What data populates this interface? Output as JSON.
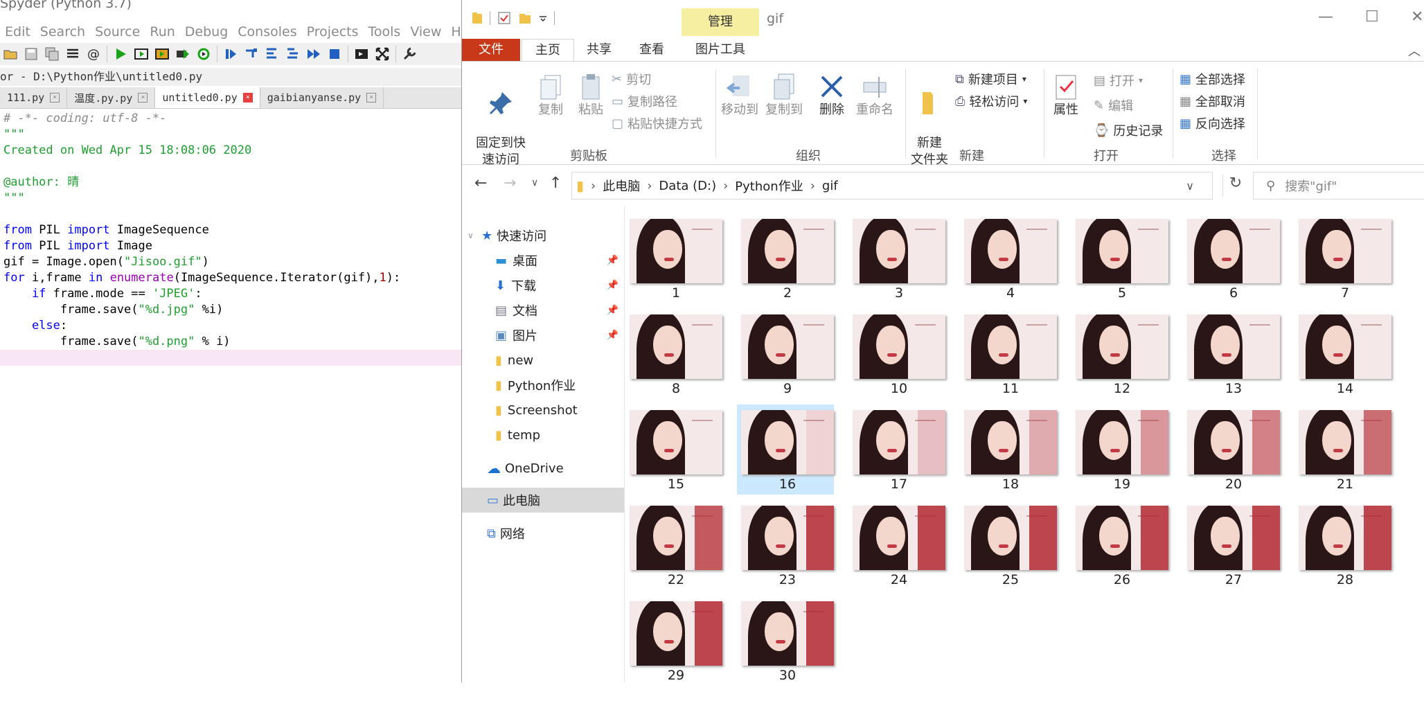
{
  "spyder": {
    "title": "Spyder (Python 3.7)",
    "menu": [
      "Edit",
      "Search",
      "Source",
      "Run",
      "Debug",
      "Consoles",
      "Projects",
      "Tools",
      "View",
      "Help"
    ],
    "path": "or - D:\\Python作业\\untitled0.py",
    "tabs": [
      {
        "label": "111.py",
        "active": false
      },
      {
        "label": "温度.py.py",
        "active": false
      },
      {
        "label": "untitled0.py",
        "active": true
      },
      {
        "label": "gaibianyanse.py",
        "active": false
      }
    ],
    "code": {
      "l1": "# -*- coding: utf-8 -*-",
      "l2": "\"\"\"",
      "l3": "Created on Wed Apr 15 18:08:06 2020",
      "l5": "@author: 晴",
      "l6": "\"\"\"",
      "l8a": "from",
      "l8b": " PIL ",
      "l8c": "import",
      "l8d": " ImageSequence",
      "l9a": "from",
      "l9b": " PIL ",
      "l9c": "import",
      "l9d": " Image",
      "l10a": "gif = Image.open(",
      "l10b": "\"Jisoo.gif\"",
      "l10c": ")",
      "l11a": "for",
      "l11b": " i,frame ",
      "l11c": "in",
      "l11d": " ",
      "l11e": "enumerate",
      "l11f": "(ImageSequence.Iterator(gif),",
      "l11g": "1",
      "l11h": "):",
      "l12a": "    if",
      "l12b": " frame.mode == ",
      "l12c": "'JPEG'",
      "l12d": ":",
      "l13a": "        frame.save(",
      "l13b": "\"%d.jpg\"",
      "l13c": " %i)",
      "l14a": "    else",
      "l14b": ":",
      "l15a": "        frame.save(",
      "l15b": "\"%d.png\"",
      "l15c": " % i)"
    }
  },
  "explorer": {
    "window_title": "gif",
    "manage_tab": "管理",
    "ribbon_tabs": {
      "file": "文件",
      "home": "主页",
      "share": "共享",
      "view": "查看",
      "picture_tools": "图片工具"
    },
    "clipboard": {
      "pin": "固定到快\n速访问",
      "copy": "复制",
      "paste": "粘贴",
      "cut": "剪切",
      "copy_path": "复制路径",
      "paste_shortcut": "粘贴快捷方式",
      "label": "剪贴板"
    },
    "organize": {
      "move_to": "移动到",
      "copy_to": "复制到",
      "delete": "删除",
      "rename": "重命名",
      "label": "组织"
    },
    "new": {
      "new_folder": "新建\n文件夹",
      "new_item": "新建项目",
      "easy_access": "轻松访问",
      "label": "新建"
    },
    "open": {
      "properties": "属性",
      "open": "打开",
      "edit": "编辑",
      "history": "历史记录",
      "label": "打开"
    },
    "select": {
      "select_all": "全部选择",
      "select_none": "全部取消",
      "invert": "反向选择",
      "label": "选择"
    },
    "address": [
      "此电脑",
      "Data (D:)",
      "Python作业",
      "gif"
    ],
    "search_placeholder": "搜索\"gif\"",
    "nav": {
      "quick_access": "快速访问",
      "desktop": "桌面",
      "downloads": "下载",
      "documents": "文档",
      "pictures": "图片",
      "new": "new",
      "python": "Python作业",
      "screenshot": "Screenshot",
      "temp": "temp",
      "onedrive": "OneDrive",
      "this_pc": "此电脑",
      "network": "网络"
    },
    "files": [
      "1",
      "2",
      "3",
      "4",
      "5",
      "6",
      "7",
      "8",
      "9",
      "10",
      "11",
      "12",
      "13",
      "14",
      "15",
      "16",
      "17",
      "18",
      "19",
      "20",
      "21",
      "22",
      "23",
      "24",
      "25",
      "26",
      "27",
      "28",
      "29",
      "30"
    ],
    "selected_file": "16",
    "colors": {
      "file_tab": "#c8391a",
      "manage_tab": "#f6eea0",
      "selection": "#cce8ff"
    }
  }
}
